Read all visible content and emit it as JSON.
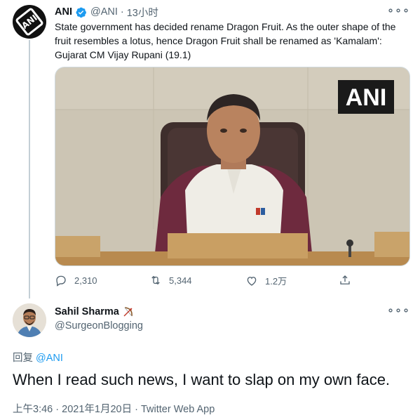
{
  "tweet": {
    "author_name": "ANI",
    "author_handle": "@ANI",
    "separator": "·",
    "time_ago": "13小时",
    "more_label": "∘∘∘",
    "text": "State government has decided rename Dragon Fruit. As the outer shape of the fruit resembles a lotus, hence Dragon Fruit shall be renamed as 'Kamalam': Gujarat CM Vijay Rupani (19.1)",
    "media_watermark": "ANI",
    "actions": {
      "reply_count": "2,310",
      "retweet_count": "5,344",
      "like_count": "1.2万"
    },
    "colors": {
      "verified": "#1d9bf0",
      "text": "#0f1419",
      "muted": "#536471"
    }
  },
  "reply": {
    "author_name": "Sahil Sharma",
    "author_handle": "@SurgeonBlogging",
    "more_label": "∘∘∘",
    "reply_prefix": "回复",
    "reply_to_handle": "@ANI",
    "text": "When I read such news, I want to slap on my own face.",
    "time": "上午3:46",
    "separator": "·",
    "date": "2021年1月20日",
    "client": "Twitter Web App",
    "colors": {
      "link": "#1d9bf0"
    }
  },
  "icons": [
    "verified-badge-icon",
    "more-icon",
    "reply-icon",
    "retweet-icon",
    "like-icon",
    "share-icon",
    "bow-arrow-emoji"
  ]
}
